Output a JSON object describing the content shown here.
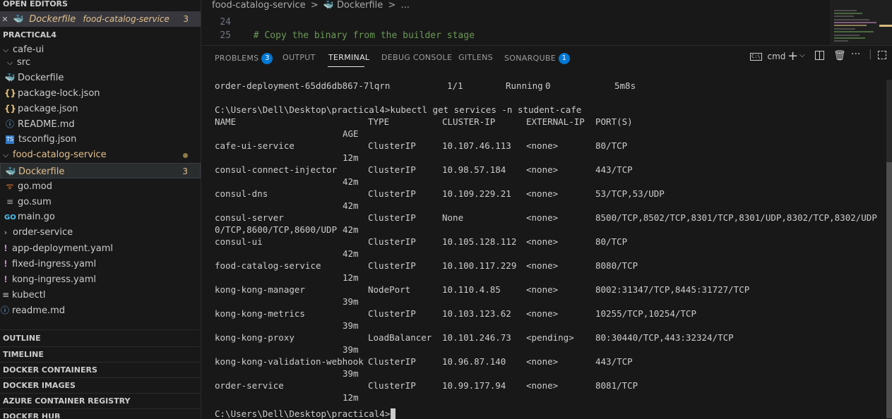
{
  "sidebar": {
    "open_editors_title": "OPEN EDITORS",
    "open_editor": {
      "name": "Dockerfile",
      "folder": "food-catalog-service",
      "problems": "3"
    },
    "workspace_title": "PRACTICAL4",
    "tree": {
      "cafe_ui": "cafe-ui",
      "src": "src",
      "dockerfile": "Dockerfile",
      "package_lock": "package-lock.json",
      "package_json": "package.json",
      "readme_md": "README.md",
      "tsconfig": "tsconfig.json",
      "food_catalog": "food-catalog-service",
      "food_dockerfile": "Dockerfile",
      "food_dockerfile_count": "3",
      "go_mod": "go.mod",
      "go_sum": "go.sum",
      "main_go": "main.go",
      "order_service": "order-service",
      "app_deployment": "app-deployment.yaml",
      "fixed_ingress": "fixed-ingress.yaml",
      "kong_ingress": "kong-ingress.yaml",
      "kubectl": "kubectl",
      "readme_lower": "readme.md"
    },
    "sections": [
      "OUTLINE",
      "TIMELINE",
      "DOCKER CONTAINERS",
      "DOCKER IMAGES",
      "AZURE CONTAINER REGISTRY",
      "DOCKER HUB"
    ]
  },
  "editor": {
    "breadcrumb": {
      "folder": "food-catalog-service",
      "sep": ">",
      "file": "Dockerfile",
      "more": "..."
    },
    "lines": [
      {
        "num": "24",
        "code": ""
      },
      {
        "num": "25",
        "code": "# Copy the binary from the builder stage"
      }
    ]
  },
  "panel": {
    "tabs": {
      "problems": "PROBLEMS",
      "problems_count": "3",
      "output": "OUTPUT",
      "terminal": "TERMINAL",
      "debug": "DEBUG CONSOLE",
      "gitlens": "GITLENS",
      "sonarqube": "SONARQUBE",
      "sonarqube_count": "1"
    },
    "toolbar": {
      "shell_name": "cmd",
      "shell_icon_text": "C:\\"
    }
  },
  "terminal": {
    "prev_row": {
      "name": "order-deployment-65dd6db867-7lqrn",
      "ready": "1/1",
      "status": "Running",
      "restarts": "0",
      "age": "5m8s"
    },
    "command": "C:\\Users\\Dell\\Desktop\\practical4>kubectl get services -n student-cafe",
    "headers": {
      "name": "NAME",
      "type": "TYPE",
      "cluster_ip": "CLUSTER-IP",
      "external_ip": "EXTERNAL-IP",
      "ports": "PORT(S)",
      "age": "AGE"
    },
    "services": [
      {
        "name": "cafe-ui-service",
        "type": "ClusterIP",
        "cluster_ip": "10.107.46.113",
        "external_ip": "<none>",
        "ports": "80/TCP",
        "ports_cont": "",
        "age": "12m"
      },
      {
        "name": "consul-connect-injector",
        "type": "ClusterIP",
        "cluster_ip": "10.98.57.184",
        "external_ip": "<none>",
        "ports": "443/TCP",
        "ports_cont": "",
        "age": "42m"
      },
      {
        "name": "consul-dns",
        "type": "ClusterIP",
        "cluster_ip": "10.109.229.21",
        "external_ip": "<none>",
        "ports": "53/TCP,53/UDP",
        "ports_cont": "",
        "age": "42m"
      },
      {
        "name": "consul-server",
        "type": "ClusterIP",
        "cluster_ip": "None",
        "external_ip": "<none>",
        "ports": "8500/TCP,8502/TCP,8301/TCP,8301/UDP,8302/TCP,8302/UDP,830",
        "ports_cont": "0/TCP,8600/TCP,8600/UDP",
        "age": "42m"
      },
      {
        "name": "consul-ui",
        "type": "ClusterIP",
        "cluster_ip": "10.105.128.112",
        "external_ip": "<none>",
        "ports": "80/TCP",
        "ports_cont": "",
        "age": "42m"
      },
      {
        "name": "food-catalog-service",
        "type": "ClusterIP",
        "cluster_ip": "10.100.117.229",
        "external_ip": "<none>",
        "ports": "8080/TCP",
        "ports_cont": "",
        "age": "12m"
      },
      {
        "name": "kong-kong-manager",
        "type": "NodePort",
        "cluster_ip": "10.110.4.85",
        "external_ip": "<none>",
        "ports": "8002:31347/TCP,8445:31727/TCP",
        "ports_cont": "",
        "age": "39m"
      },
      {
        "name": "kong-kong-metrics",
        "type": "ClusterIP",
        "cluster_ip": "10.103.123.62",
        "external_ip": "<none>",
        "ports": "10255/TCP,10254/TCP",
        "ports_cont": "",
        "age": "39m"
      },
      {
        "name": "kong-kong-proxy",
        "type": "LoadBalancer",
        "cluster_ip": "10.101.246.73",
        "external_ip": "<pending>",
        "ports": "80:30440/TCP,443:32324/TCP",
        "ports_cont": "",
        "age": "39m"
      },
      {
        "name": "kong-kong-validation-webhook",
        "type": "ClusterIP",
        "cluster_ip": "10.96.87.140",
        "external_ip": "<none>",
        "ports": "443/TCP",
        "ports_cont": "",
        "age": "39m"
      },
      {
        "name": "order-service",
        "type": "ClusterIP",
        "cluster_ip": "10.99.177.94",
        "external_ip": "<none>",
        "ports": "8081/TCP",
        "ports_cont": "",
        "age": "12m"
      }
    ],
    "prompt": "C:\\Users\\Dell\\Desktop\\practical4>"
  }
}
